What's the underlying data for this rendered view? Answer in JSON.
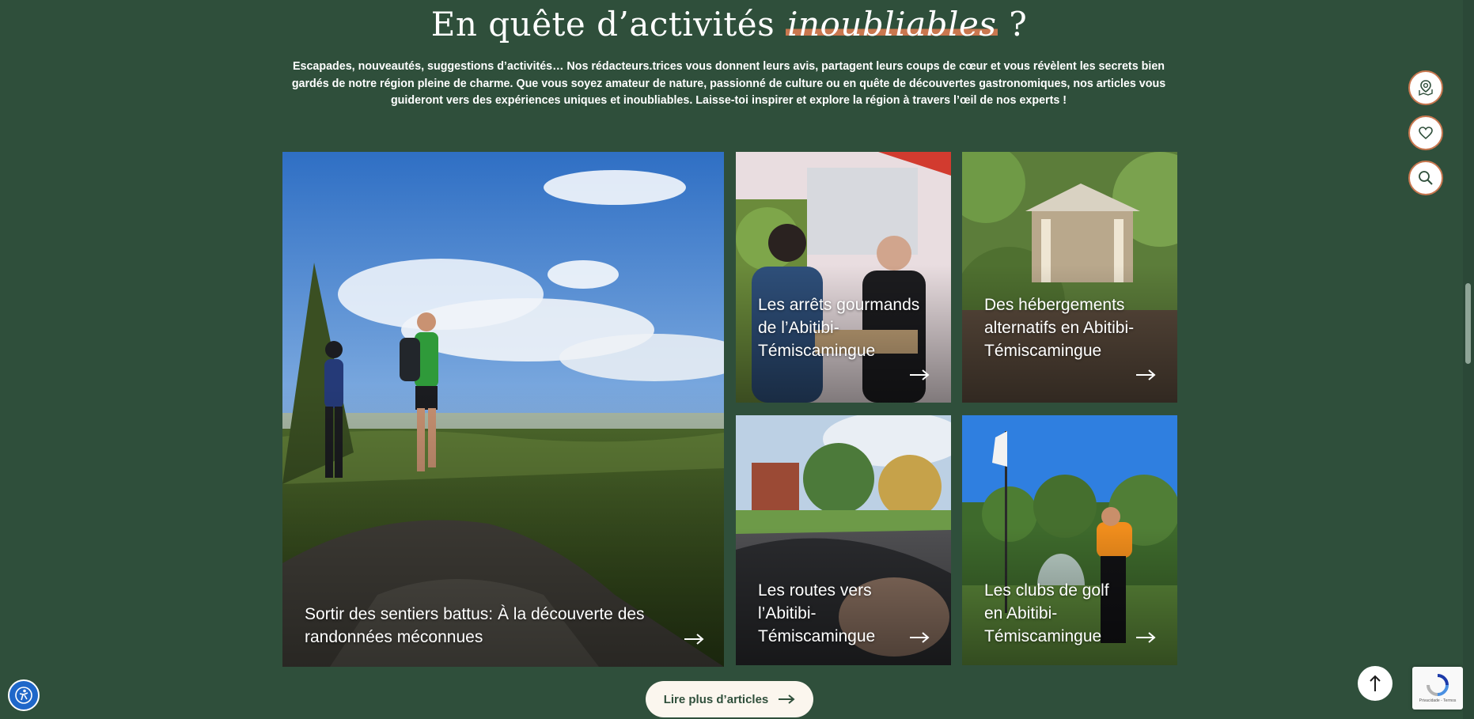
{
  "section": {
    "title_before": "En quête d’activités",
    "title_accent": "inoubliables",
    "title_after": "?",
    "intro": "Escapades, nouveautés, suggestions d’activités… Nos rédacteurs.trices vous donnent leurs avis, partagent leurs coups de cœur et vous révèlent les secrets bien gardés de notre région pleine de charme. Que vous soyez amateur de nature, passionné de culture ou en quête de découvertes gastronomiques, nos articles vous guideront vers des expériences uniques et inoubliables. Laisse-toi inspirer et explore la région à travers l’œil de nos experts !"
  },
  "articles": [
    {
      "title": "Sortir des sentiers battus: À la découverte des randonnées méconnues",
      "icon": "arrow-right-icon"
    },
    {
      "title": "Les arrêts gourmands de l’Abitibi-Témiscamingue",
      "icon": "arrow-right-icon"
    },
    {
      "title": "Des hébergements alternatifs en Abitibi-Témiscamingue",
      "icon": "arrow-right-icon"
    },
    {
      "title": "Les routes vers l’Abitibi-Témiscamingue",
      "icon": "arrow-right-icon"
    },
    {
      "title": "Les clubs de golf en Abitibi-Témiscamingue",
      "icon": "arrow-right-icon"
    }
  ],
  "more_button": {
    "label": "Lire plus d’articles",
    "icon": "arrow-right-icon"
  },
  "side_actions": [
    {
      "icon": "map-pin-icon"
    },
    {
      "icon": "heart-icon"
    },
    {
      "icon": "search-icon"
    }
  ],
  "back_to_top": {
    "icon": "arrow-up-icon"
  },
  "accessibility": {
    "icon": "accessibility-icon"
  },
  "recaptcha": {
    "links": "Privacidade - Termos",
    "icon": "recaptcha-icon"
  },
  "colors": {
    "background": "#2f4f3b",
    "accent": "#c9774f",
    "button_bg": "#fbf6ee",
    "accessibility_blue": "#1f67c9"
  }
}
